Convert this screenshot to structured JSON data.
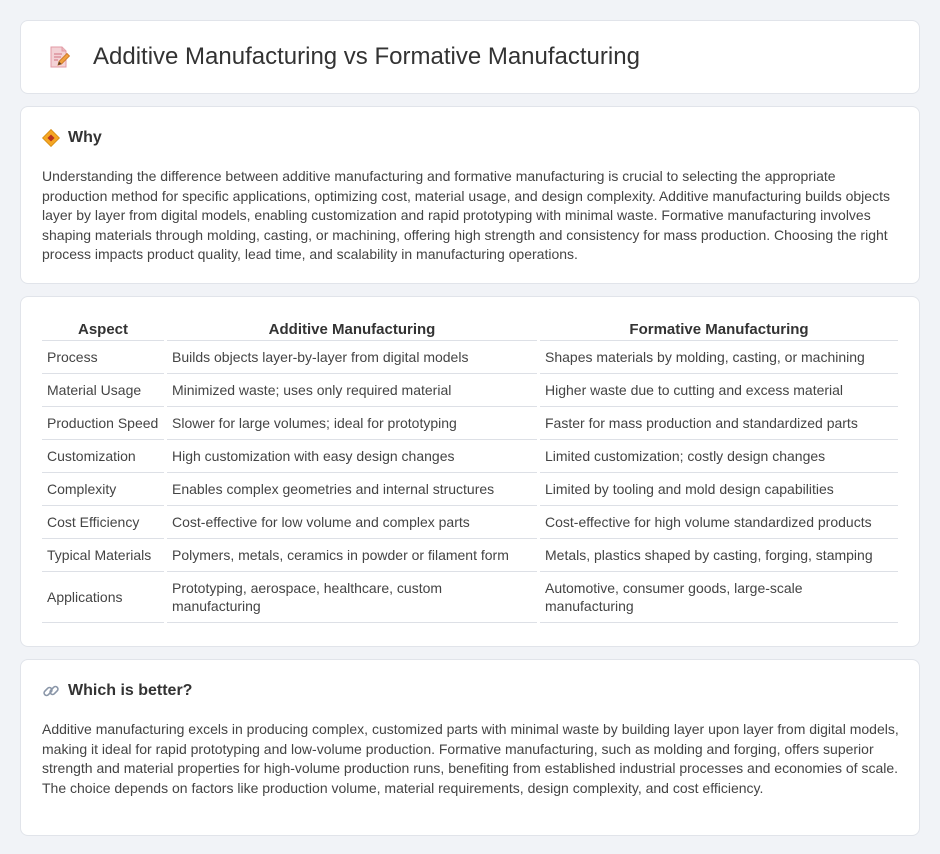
{
  "header": {
    "title": "Additive Manufacturing vs Formative Manufacturing",
    "icon": "document-pencil-icon"
  },
  "why": {
    "heading": "Why",
    "icon": "diamond-sign-icon",
    "text": "Understanding the difference between additive manufacturing and formative manufacturing is crucial to selecting the appropriate production method for specific applications, optimizing cost, material usage, and design complexity. Additive manufacturing builds objects layer by layer from digital models, enabling customization and rapid prototyping with minimal waste. Formative manufacturing involves shaping materials through molding, casting, or machining, offering high strength and consistency for mass production. Choosing the right process impacts product quality, lead time, and scalability in manufacturing operations."
  },
  "comparison": {
    "columns": [
      "Aspect",
      "Additive Manufacturing",
      "Formative Manufacturing"
    ],
    "rows": [
      [
        "Process",
        "Builds objects layer-by-layer from digital models",
        "Shapes materials by molding, casting, or machining"
      ],
      [
        "Material Usage",
        "Minimized waste; uses only required material",
        "Higher waste due to cutting and excess material"
      ],
      [
        "Production Speed",
        "Slower for large volumes; ideal for prototyping",
        "Faster for mass production and standardized parts"
      ],
      [
        "Customization",
        "High customization with easy design changes",
        "Limited customization; costly design changes"
      ],
      [
        "Complexity",
        "Enables complex geometries and internal structures",
        "Limited by tooling and mold design capabilities"
      ],
      [
        "Cost Efficiency",
        "Cost-effective for low volume and complex parts",
        "Cost-effective for high volume standardized products"
      ],
      [
        "Typical Materials",
        "Polymers, metals, ceramics in powder or filament form",
        "Metals, plastics shaped by casting, forging, stamping"
      ],
      [
        "Applications",
        "Prototyping, aerospace, healthcare, custom manufacturing",
        "Automotive, consumer goods, large-scale manufacturing"
      ]
    ]
  },
  "better": {
    "heading": "Which is better?",
    "icon": "link-icon",
    "text": "Additive manufacturing excels in producing complex, customized parts with minimal waste by building layer upon layer from digital models, making it ideal for rapid prototyping and low-volume production. Formative manufacturing, such as molding and forging, offers superior strength and material properties for high-volume production runs, benefiting from established industrial processes and economies of scale. The choice depends on factors like production volume, material requirements, design complexity, and cost efficiency."
  }
}
